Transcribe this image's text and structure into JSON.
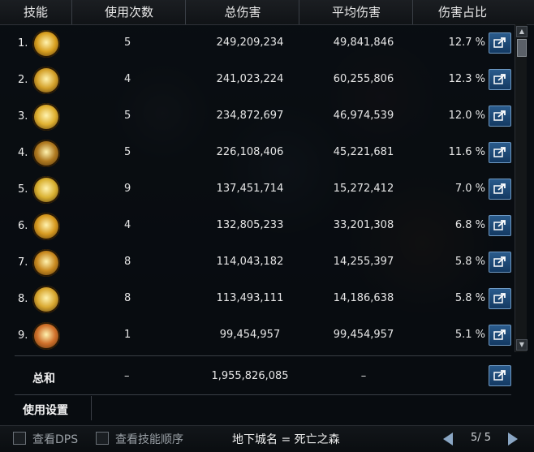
{
  "header": {
    "skill": "技能",
    "uses": "使用次数",
    "total": "总伤害",
    "avg": "平均伤害",
    "pct": "伤害占比"
  },
  "rows": [
    {
      "idx": "1.",
      "icon": "crown-skill-icon",
      "color": "#d9a020",
      "uses": "5",
      "total": "249,209,234",
      "avg": "49,841,846",
      "pct": "12.7 %"
    },
    {
      "idx": "2.",
      "icon": "crescent-slash-skill-icon",
      "color": "#d4a12a",
      "uses": "4",
      "total": "241,023,224",
      "avg": "60,255,806",
      "pct": "12.3 %"
    },
    {
      "idx": "3.",
      "icon": "flame-burst-skill-icon",
      "color": "#e0b030",
      "uses": "5",
      "total": "234,872,697",
      "avg": "46,974,539",
      "pct": "12.0 %"
    },
    {
      "idx": "4.",
      "icon": "chain-strike-skill-icon",
      "color": "#b07a20",
      "uses": "5",
      "total": "226,108,406",
      "avg": "45,221,681",
      "pct": "11.6 %"
    },
    {
      "idx": "5.",
      "icon": "shield-skill-icon",
      "color": "#d9b030",
      "uses": "9",
      "total": "137,451,714",
      "avg": "15,272,412",
      "pct": "7.0 %"
    },
    {
      "idx": "6.",
      "icon": "flower-burst-skill-icon",
      "color": "#d79a20",
      "uses": "4",
      "total": "132,805,233",
      "avg": "33,201,308",
      "pct": "6.8 %"
    },
    {
      "idx": "7.",
      "icon": "slash-wave-skill-icon",
      "color": "#c98a20",
      "uses": "8",
      "total": "114,043,182",
      "avg": "14,255,397",
      "pct": "5.8 %"
    },
    {
      "idx": "8.",
      "icon": "cross-seal-skill-icon",
      "color": "#d9a830",
      "uses": "8",
      "total": "113,493,111",
      "avg": "14,186,638",
      "pct": "5.8 %"
    },
    {
      "idx": "9.",
      "icon": "demon-face-skill-icon",
      "color": "#d0702a",
      "uses": "1",
      "total": "99,454,957",
      "avg": "99,454,957",
      "pct": "5.1 %"
    }
  ],
  "summary": {
    "label": "总和",
    "uses": "–",
    "total": "1,955,826,085",
    "avg": "–"
  },
  "settings_tab": "使用设置",
  "bottom": {
    "show_dps": "查看DPS",
    "show_order": "查看技能顺序",
    "dungeon": "地下城名 = 死亡之森",
    "page": "5/ 5"
  }
}
